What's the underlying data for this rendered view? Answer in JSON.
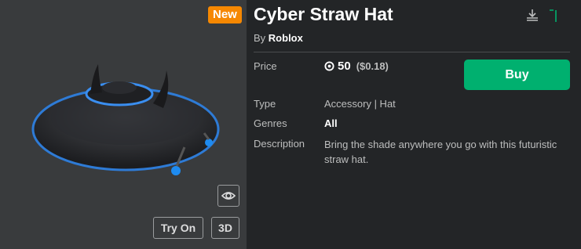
{
  "preview": {
    "badge_new": "New",
    "try_on_label": "Try On",
    "view_3d_label": "3D",
    "eye_icon": "eye-icon"
  },
  "item": {
    "title": "Cyber Straw Hat",
    "by_prefix": "By",
    "creator": "Roblox",
    "download_icon": "download-icon",
    "flag_icon": "flag-icon"
  },
  "details": {
    "price_label": "Price",
    "robux_icon": "robux-icon",
    "price_amount": "50",
    "price_usd": "($0.18)",
    "buy_label": "Buy",
    "type_label": "Type",
    "type_value": "Accessory | Hat",
    "genres_label": "Genres",
    "genres_value": "All",
    "description_label": "Description",
    "description_value": "Bring the shade anywhere you go with this futuristic straw hat."
  },
  "colors": {
    "background": "#232527",
    "preview_bg": "#393b3d",
    "new_badge": "#f68802",
    "buy_button": "#00b06f",
    "hat_glow": "#1e90ff"
  }
}
